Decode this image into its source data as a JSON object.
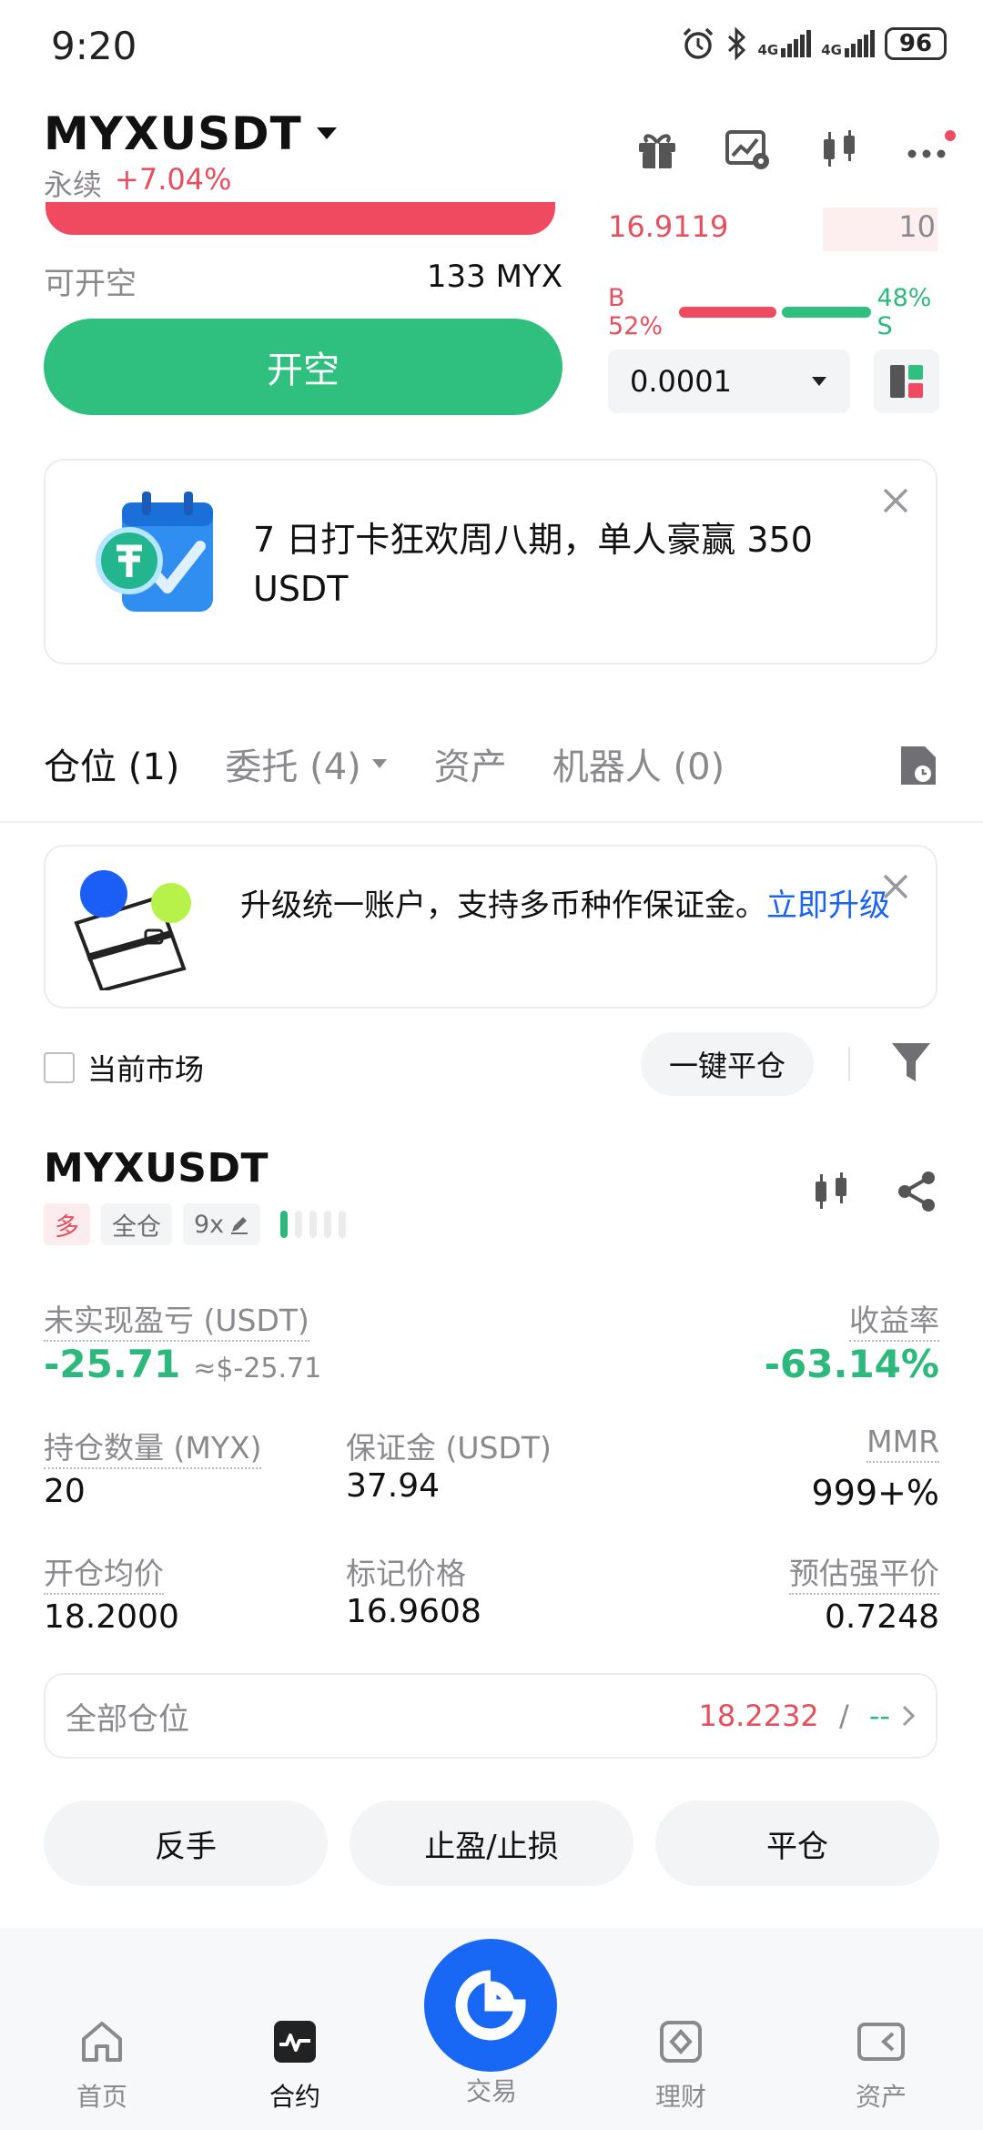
{
  "status_bar": {
    "time": "9:20",
    "battery": "96",
    "net1": "4G",
    "net2": "4G"
  },
  "header": {
    "symbol": "MYXUSDT",
    "type": "永续",
    "change": "+7.04%"
  },
  "order_panel": {
    "available_label": "可开空",
    "available_value": "133 MYX",
    "open_short_label": "开空",
    "book_price": "16.9119",
    "book_qty": "10",
    "buy_ratio": "B 52%",
    "sell_ratio": "48% S",
    "buy_ratio_value": 0.52,
    "precision": "0.0001"
  },
  "promo": {
    "text": "7 日打卡狂欢周八期，单人豪赢 350 USDT"
  },
  "tabs": [
    {
      "label": "仓位 (1)"
    },
    {
      "label": "委托 (4)"
    },
    {
      "label": "资产"
    },
    {
      "label": "机器人 (0)"
    }
  ],
  "upgrade_banner": {
    "text": "升级统一账户，支持多币种作保证金。",
    "link": "立即升级"
  },
  "filter": {
    "current_market": "当前市场",
    "close_all": "一键平仓"
  },
  "position": {
    "symbol": "MYXUSDT",
    "side": "多",
    "margin_mode": "全仓",
    "leverage": "9x",
    "leverage_level": 1,
    "upnl_label": "未实现盈亏 (USDT)",
    "upnl_value": "-25.71",
    "upnl_usd": "≈$-25.71",
    "roe_label": "收益率",
    "roe_value": "-63.14%",
    "qty_label": "持仓数量 (MYX)",
    "qty_value": "20",
    "margin_label": "保证金 (USDT)",
    "margin_value": "37.94",
    "mmr_label": "MMR",
    "mmr_value": "999+%",
    "entry_label": "开仓均价",
    "entry_value": "18.2000",
    "mark_label": "标记价格",
    "mark_value": "16.9608",
    "liq_label": "预估强平价",
    "liq_value": "0.7248",
    "all_positions_label": "全部仓位",
    "all_positions_price": "18.2232",
    "all_positions_sep": " / ",
    "all_positions_other": "--"
  },
  "actions": {
    "reverse": "反手",
    "tp_sl": "止盈/止损",
    "close": "平仓"
  },
  "nav": {
    "home": "首页",
    "futures": "合约",
    "trade": "交易",
    "earn": "理财",
    "assets": "资产"
  },
  "colors": {
    "red": "#e5505f",
    "green": "#2db87d",
    "blue": "#1867f5",
    "orange": "#f09a48"
  }
}
